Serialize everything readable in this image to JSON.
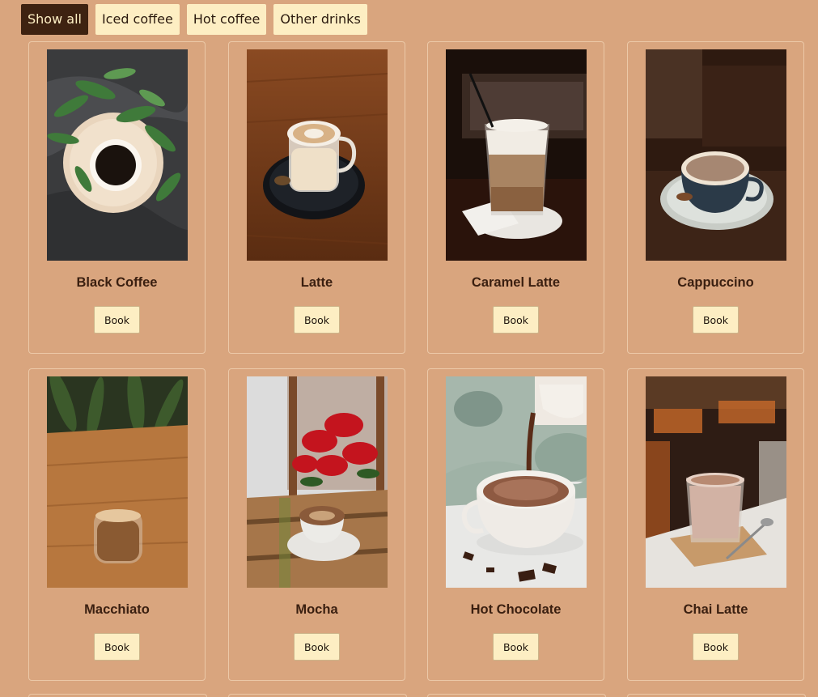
{
  "filters": {
    "show_all": "Show all",
    "iced_coffee": "Iced coffee",
    "hot_coffee": "Hot coffee",
    "other_drinks": "Other drinks",
    "active": "Show all"
  },
  "book_label": "Book",
  "products": [
    {
      "name": "Black Coffee",
      "photo": "black-coffee-photo"
    },
    {
      "name": "Latte",
      "photo": "latte-photo"
    },
    {
      "name": "Caramel Latte",
      "photo": "caramel-latte-photo"
    },
    {
      "name": "Cappuccino",
      "photo": "cappuccino-photo"
    },
    {
      "name": "Macchiato",
      "photo": "macchiato-photo"
    },
    {
      "name": "Mocha",
      "photo": "mocha-photo"
    },
    {
      "name": "Hot Chocolate",
      "photo": "hot-chocolate-photo"
    },
    {
      "name": "Chai Latte",
      "photo": "chai-latte-photo"
    }
  ],
  "colors": {
    "page_background": "#d9a57e",
    "button_background": "#fdeec3",
    "active_filter_background": "#3e2211",
    "title_text": "#3a1f10"
  }
}
